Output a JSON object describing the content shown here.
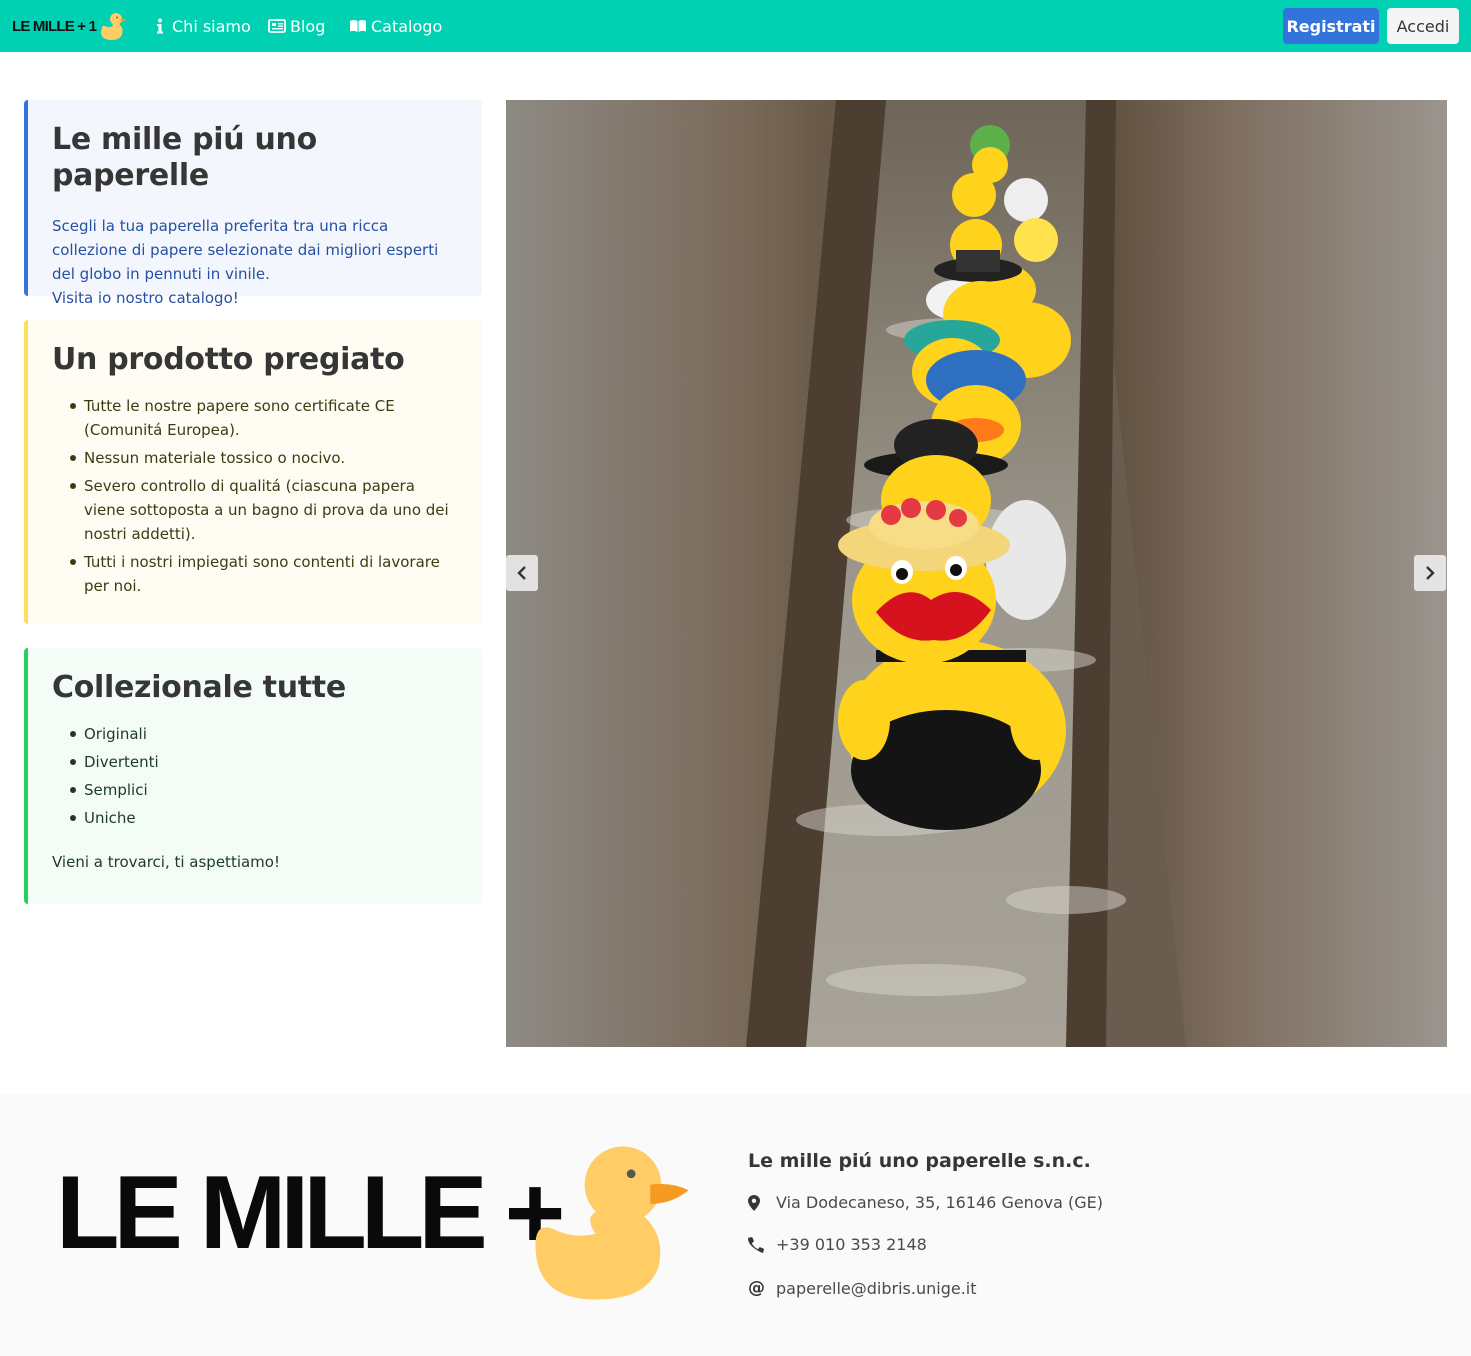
{
  "navbar": {
    "brand": "LE MILLE + 1",
    "items": [
      {
        "label": "Chi siamo",
        "icon": "info-icon"
      },
      {
        "label": "Blog",
        "icon": "newspaper-icon"
      },
      {
        "label": "Catalogo",
        "icon": "book-icon"
      }
    ],
    "register_label": "Registrati",
    "login_label": "Accedi",
    "colors": {
      "navbar": "#00d1b2",
      "primary": "#3273dc"
    }
  },
  "intro": {
    "title": "Le mille piú uno paperelle",
    "text": "Scegli la tua paperella preferita tra una ricca collezione di papere selezionate dai migliori esperti del globo in pennuti in vinile.",
    "cta": "Visita io nostro catalogo!"
  },
  "quality": {
    "title": "Un prodotto pregiato",
    "items": [
      "Tutte le nostre papere sono certificate CE (Comunitá Europea).",
      "Nessun materiale tossico o nocivo.",
      "Severo controllo di qualitá (ciascuna papera viene sottoposta a un bagno di prova da uno dei nostri addetti).",
      "Tutti i nostri impiegati sono contenti di lavorare per noi."
    ]
  },
  "collect": {
    "title": "Collezionale tutte",
    "items": [
      "Originali",
      "Divertenti",
      "Semplici",
      "Uniche"
    ],
    "closing": "Vieni a trovarci, ti aspettiamo!"
  },
  "carousel": {
    "prev_icon": "chevron-left-icon",
    "next_icon": "chevron-right-icon"
  },
  "footer": {
    "logo_text": "LE MILLE + 1",
    "company": "Le mille piú uno paperelle s.n.c.",
    "address": "Via Dodecaneso, 35, 16146 Genova (GE)",
    "phone": "+39 010 353 2148",
    "email": "paperelle@dibris.unige.it"
  }
}
